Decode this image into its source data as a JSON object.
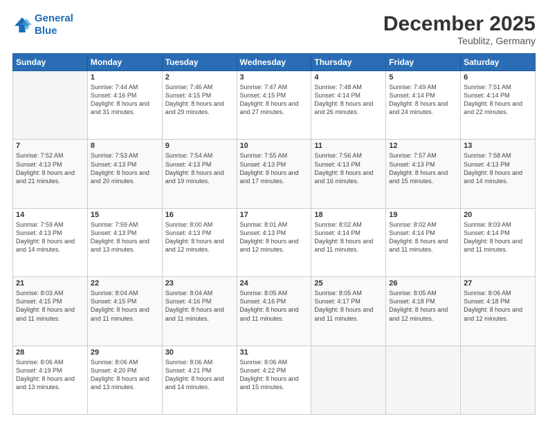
{
  "logo": {
    "line1": "General",
    "line2": "Blue"
  },
  "title": "December 2025",
  "subtitle": "Teublitz, Germany",
  "weekdays": [
    "Sunday",
    "Monday",
    "Tuesday",
    "Wednesday",
    "Thursday",
    "Friday",
    "Saturday"
  ],
  "weeks": [
    [
      {
        "day": "",
        "sunrise": "",
        "sunset": "",
        "daylight": ""
      },
      {
        "day": "1",
        "sunrise": "Sunrise: 7:44 AM",
        "sunset": "Sunset: 4:16 PM",
        "daylight": "Daylight: 8 hours and 31 minutes."
      },
      {
        "day": "2",
        "sunrise": "Sunrise: 7:46 AM",
        "sunset": "Sunset: 4:15 PM",
        "daylight": "Daylight: 8 hours and 29 minutes."
      },
      {
        "day": "3",
        "sunrise": "Sunrise: 7:47 AM",
        "sunset": "Sunset: 4:15 PM",
        "daylight": "Daylight: 8 hours and 27 minutes."
      },
      {
        "day": "4",
        "sunrise": "Sunrise: 7:48 AM",
        "sunset": "Sunset: 4:14 PM",
        "daylight": "Daylight: 8 hours and 26 minutes."
      },
      {
        "day": "5",
        "sunrise": "Sunrise: 7:49 AM",
        "sunset": "Sunset: 4:14 PM",
        "daylight": "Daylight: 8 hours and 24 minutes."
      },
      {
        "day": "6",
        "sunrise": "Sunrise: 7:51 AM",
        "sunset": "Sunset: 4:14 PM",
        "daylight": "Daylight: 8 hours and 22 minutes."
      }
    ],
    [
      {
        "day": "7",
        "sunrise": "Sunrise: 7:52 AM",
        "sunset": "Sunset: 4:13 PM",
        "daylight": "Daylight: 8 hours and 21 minutes."
      },
      {
        "day": "8",
        "sunrise": "Sunrise: 7:53 AM",
        "sunset": "Sunset: 4:13 PM",
        "daylight": "Daylight: 8 hours and 20 minutes."
      },
      {
        "day": "9",
        "sunrise": "Sunrise: 7:54 AM",
        "sunset": "Sunset: 4:13 PM",
        "daylight": "Daylight: 8 hours and 19 minutes."
      },
      {
        "day": "10",
        "sunrise": "Sunrise: 7:55 AM",
        "sunset": "Sunset: 4:13 PM",
        "daylight": "Daylight: 8 hours and 17 minutes."
      },
      {
        "day": "11",
        "sunrise": "Sunrise: 7:56 AM",
        "sunset": "Sunset: 4:13 PM",
        "daylight": "Daylight: 8 hours and 16 minutes."
      },
      {
        "day": "12",
        "sunrise": "Sunrise: 7:57 AM",
        "sunset": "Sunset: 4:13 PM",
        "daylight": "Daylight: 8 hours and 15 minutes."
      },
      {
        "day": "13",
        "sunrise": "Sunrise: 7:58 AM",
        "sunset": "Sunset: 4:13 PM",
        "daylight": "Daylight: 8 hours and 14 minutes."
      }
    ],
    [
      {
        "day": "14",
        "sunrise": "Sunrise: 7:59 AM",
        "sunset": "Sunset: 4:13 PM",
        "daylight": "Daylight: 8 hours and 14 minutes."
      },
      {
        "day": "15",
        "sunrise": "Sunrise: 7:59 AM",
        "sunset": "Sunset: 4:13 PM",
        "daylight": "Daylight: 8 hours and 13 minutes."
      },
      {
        "day": "16",
        "sunrise": "Sunrise: 8:00 AM",
        "sunset": "Sunset: 4:13 PM",
        "daylight": "Daylight: 8 hours and 12 minutes."
      },
      {
        "day": "17",
        "sunrise": "Sunrise: 8:01 AM",
        "sunset": "Sunset: 4:13 PM",
        "daylight": "Daylight: 8 hours and 12 minutes."
      },
      {
        "day": "18",
        "sunrise": "Sunrise: 8:02 AM",
        "sunset": "Sunset: 4:14 PM",
        "daylight": "Daylight: 8 hours and 11 minutes."
      },
      {
        "day": "19",
        "sunrise": "Sunrise: 8:02 AM",
        "sunset": "Sunset: 4:14 PM",
        "daylight": "Daylight: 8 hours and 11 minutes."
      },
      {
        "day": "20",
        "sunrise": "Sunrise: 8:03 AM",
        "sunset": "Sunset: 4:14 PM",
        "daylight": "Daylight: 8 hours and 11 minutes."
      }
    ],
    [
      {
        "day": "21",
        "sunrise": "Sunrise: 8:03 AM",
        "sunset": "Sunset: 4:15 PM",
        "daylight": "Daylight: 8 hours and 11 minutes."
      },
      {
        "day": "22",
        "sunrise": "Sunrise: 8:04 AM",
        "sunset": "Sunset: 4:15 PM",
        "daylight": "Daylight: 8 hours and 11 minutes."
      },
      {
        "day": "23",
        "sunrise": "Sunrise: 8:04 AM",
        "sunset": "Sunset: 4:16 PM",
        "daylight": "Daylight: 8 hours and 11 minutes."
      },
      {
        "day": "24",
        "sunrise": "Sunrise: 8:05 AM",
        "sunset": "Sunset: 4:16 PM",
        "daylight": "Daylight: 8 hours and 11 minutes."
      },
      {
        "day": "25",
        "sunrise": "Sunrise: 8:05 AM",
        "sunset": "Sunset: 4:17 PM",
        "daylight": "Daylight: 8 hours and 11 minutes."
      },
      {
        "day": "26",
        "sunrise": "Sunrise: 8:05 AM",
        "sunset": "Sunset: 4:18 PM",
        "daylight": "Daylight: 8 hours and 12 minutes."
      },
      {
        "day": "27",
        "sunrise": "Sunrise: 8:06 AM",
        "sunset": "Sunset: 4:18 PM",
        "daylight": "Daylight: 8 hours and 12 minutes."
      }
    ],
    [
      {
        "day": "28",
        "sunrise": "Sunrise: 8:06 AM",
        "sunset": "Sunset: 4:19 PM",
        "daylight": "Daylight: 8 hours and 13 minutes."
      },
      {
        "day": "29",
        "sunrise": "Sunrise: 8:06 AM",
        "sunset": "Sunset: 4:20 PM",
        "daylight": "Daylight: 8 hours and 13 minutes."
      },
      {
        "day": "30",
        "sunrise": "Sunrise: 8:06 AM",
        "sunset": "Sunset: 4:21 PM",
        "daylight": "Daylight: 8 hours and 14 minutes."
      },
      {
        "day": "31",
        "sunrise": "Sunrise: 8:06 AM",
        "sunset": "Sunset: 4:22 PM",
        "daylight": "Daylight: 8 hours and 15 minutes."
      },
      {
        "day": "",
        "sunrise": "",
        "sunset": "",
        "daylight": ""
      },
      {
        "day": "",
        "sunrise": "",
        "sunset": "",
        "daylight": ""
      },
      {
        "day": "",
        "sunrise": "",
        "sunset": "",
        "daylight": ""
      }
    ]
  ]
}
